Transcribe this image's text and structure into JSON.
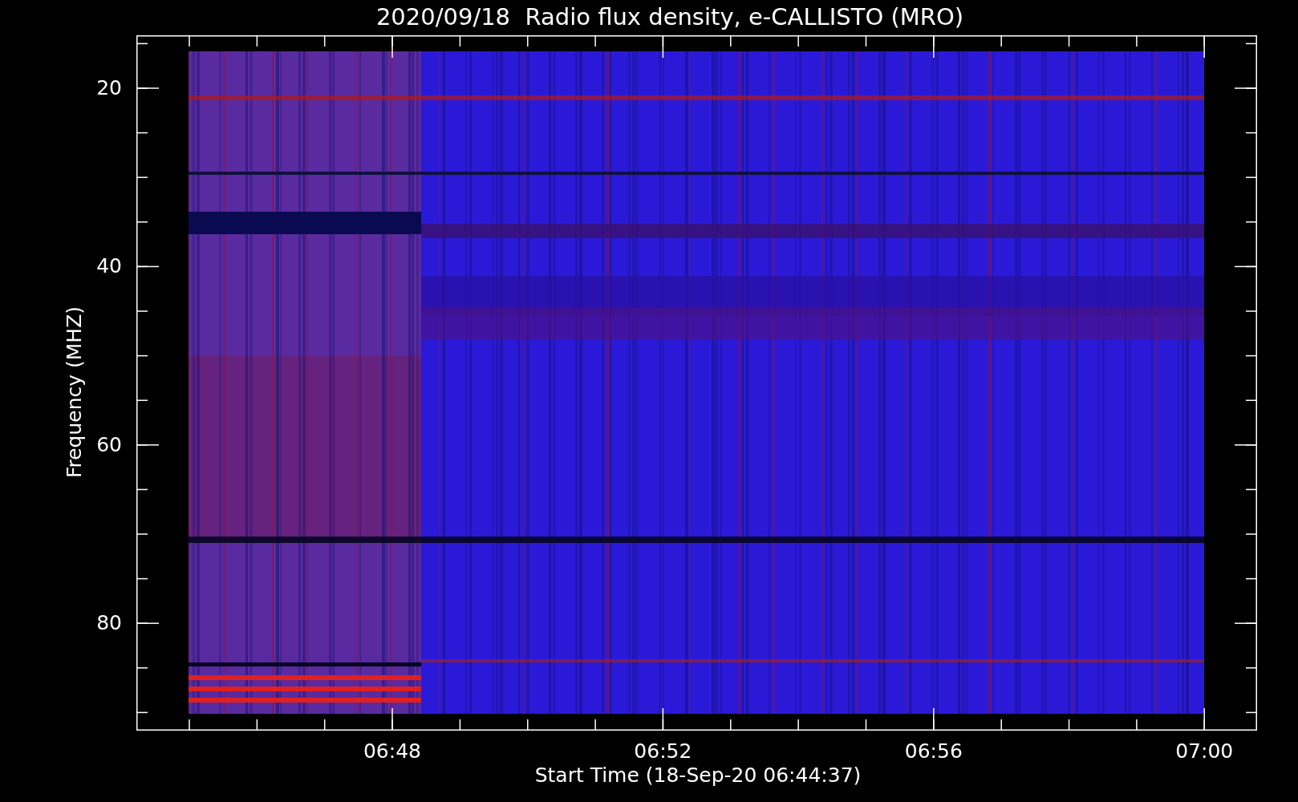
{
  "plot": {
    "title": "2020/09/18  Radio flux density, e-CALLISTO (MRO)",
    "ylabel": "Frequency (MHZ)",
    "xlabel": "Start Time (18-Sep-20 06:44:37)",
    "yticks": [
      "20",
      "40",
      "60",
      "80"
    ],
    "xticks": [
      "06:48",
      "06:52",
      "06:56",
      "07:00"
    ]
  }
}
